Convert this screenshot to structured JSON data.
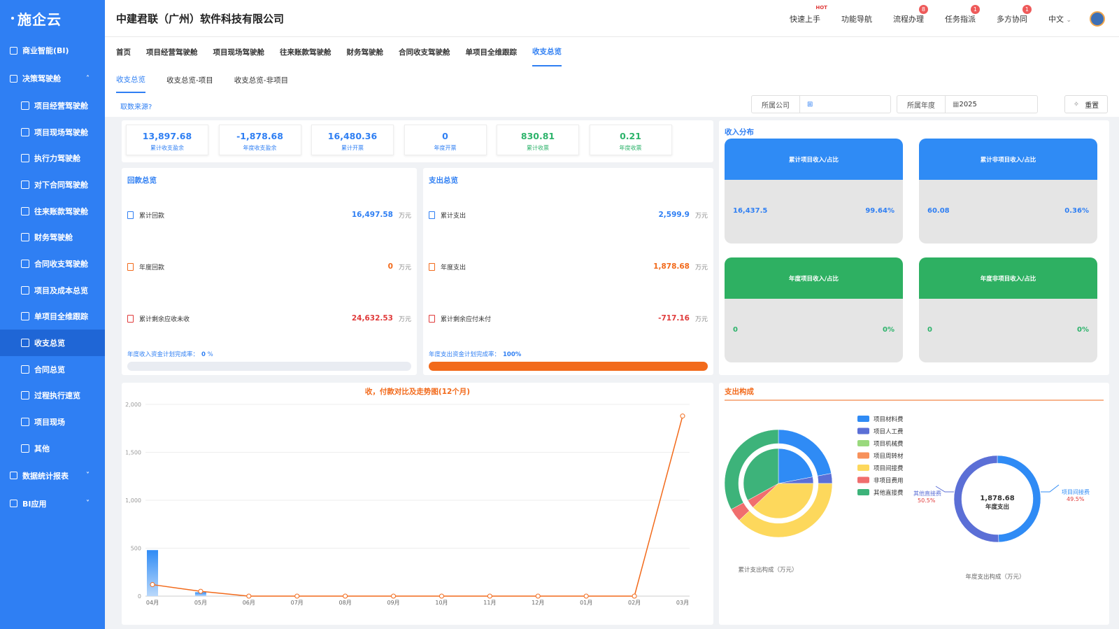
{
  "sidebar": {
    "logo": "施企云",
    "items": [
      {
        "label": "商业智能(BI)",
        "icon": "bi-grid-icon",
        "level": 0
      },
      {
        "label": "决策驾驶舱",
        "icon": "dashboard-icon",
        "level": 0,
        "expanded": true
      },
      {
        "label": "项目经营驾驶舱",
        "icon": "grid-icon",
        "level": 1
      },
      {
        "label": "项目现场驾驶舱",
        "icon": "doc-icon",
        "level": 1
      },
      {
        "label": "执行力驾驶舱",
        "icon": "calendar-check-icon",
        "level": 1
      },
      {
        "label": "对下合同驾驶舱",
        "icon": "contract-icon",
        "level": 1
      },
      {
        "label": "往来账款驾驶舱",
        "icon": "ledger-icon",
        "level": 1
      },
      {
        "label": "财务驾驶舱",
        "icon": "grid-icon",
        "level": 1
      },
      {
        "label": "合同收支驾驶舱",
        "icon": "target-icon",
        "level": 1
      },
      {
        "label": "项目及成本总览",
        "icon": "doc-icon",
        "level": 1
      },
      {
        "label": "单项目全维跟踪",
        "icon": "doc-icon",
        "level": 1
      },
      {
        "label": "收支总览",
        "icon": "money-icon",
        "level": 1,
        "active": true
      },
      {
        "label": "合同总览",
        "icon": "contract-icon",
        "level": 1
      },
      {
        "label": "过程执行速览",
        "icon": "table-icon",
        "level": 1
      },
      {
        "label": "项目现场",
        "icon": "layers-icon",
        "level": 1
      },
      {
        "label": "其他",
        "icon": "cube-icon",
        "level": 1
      },
      {
        "label": "数据统计报表",
        "icon": "report-icon",
        "level": 0,
        "collapsed": true
      },
      {
        "label": "BI应用",
        "icon": "app-icon",
        "level": 0,
        "collapsed": true
      }
    ]
  },
  "header": {
    "company": "中建君联（广州）软件科技有限公司",
    "links": [
      {
        "label": "快速上手",
        "badge": "HOT"
      },
      {
        "label": "功能导航",
        "badge": ""
      },
      {
        "label": "流程办理",
        "badge": "8"
      },
      {
        "label": "任务指派",
        "badge": "1"
      },
      {
        "label": "多方协同",
        "badge": "1"
      }
    ],
    "language": "中文"
  },
  "nav": {
    "tabs": [
      "首页",
      "项目经营驾驶舱",
      "项目现场驾驶舱",
      "往来账款驾驶舱",
      "财务驾驶舱",
      "合同收支驾驶舱",
      "单项目全维跟踪",
      "收支总览"
    ],
    "active": 7
  },
  "subnav": {
    "tabs": [
      "收支总览",
      "收支总览-项目",
      "收支总览-非项目"
    ],
    "active": 0
  },
  "filters": {
    "source_link": "取数来源?",
    "company_label": "所属公司",
    "year_label": "所属年度",
    "year_value": "2025",
    "reset_label": "重置"
  },
  "kpis": [
    {
      "value": "13,897.68",
      "label": "累计收支盈余",
      "color": "#2f7ff3"
    },
    {
      "value": "-1,878.68",
      "label": "年度收支盈余",
      "color": "#2f7ff3"
    },
    {
      "value": "16,480.36",
      "label": "累计开票",
      "color": "#2f7ff3"
    },
    {
      "value": "0",
      "label": "年度开票",
      "color": "#2f7ff3"
    },
    {
      "value": "830.81",
      "label": "累计收票",
      "color": "#2db36b"
    },
    {
      "value": "0.21",
      "label": "年度收票",
      "color": "#2db36b"
    }
  ],
  "receipt": {
    "title": "回款总览",
    "rows": [
      {
        "label": "累计回款",
        "value": "16,497.58",
        "unit": "万元",
        "color": "#2f7ff3"
      },
      {
        "label": "年度回款",
        "value": "0",
        "unit": "万元",
        "color": "#f26a1b"
      },
      {
        "label": "累计剩余应收未收",
        "value": "24,632.53",
        "unit": "万元",
        "color": "#e03b3b"
      }
    ],
    "rate_label": "年度收入资金计划完成率：",
    "rate_value": "0",
    "rate_unit": "%",
    "rate_pct": 0
  },
  "expense": {
    "title": "支出总览",
    "rows": [
      {
        "label": "累计支出",
        "value": "2,599.9",
        "unit": "万元",
        "color": "#2f7ff3"
      },
      {
        "label": "年度支出",
        "value": "1,878.68",
        "unit": "万元",
        "color": "#f26a1b"
      },
      {
        "label": "累计剩余应付未付",
        "value": "-717.16",
        "unit": "万元",
        "color": "#e03b3b"
      }
    ],
    "rate_label": "年度支出资金计划完成率：",
    "rate_value": "100%",
    "rate_pct": 100
  },
  "income_dist": {
    "title": "收入分布",
    "cards": [
      {
        "title": "累计项目收入/占比",
        "value": "16,437.5",
        "pct": "99.64%",
        "color": "#2f8bf5",
        "value_color": "#2f7ff3"
      },
      {
        "title": "累计非项目收入/占比",
        "value": "60.08",
        "pct": "0.36%",
        "color": "#2f8bf5",
        "value_color": "#2f7ff3"
      },
      {
        "title": "年度项目收入/占比",
        "value": "0",
        "pct": "0%",
        "color": "#2eb062",
        "value_color": "#2db36b"
      },
      {
        "title": "年度非项目收入/占比",
        "value": "0",
        "pct": "0%",
        "color": "#2eb062",
        "value_color": "#2db36b"
      }
    ]
  },
  "chart_data": [
    {
      "type": "line",
      "title": "收，付款对比及走势图(12个月)",
      "categories": [
        "04月",
        "05月",
        "06月",
        "07月",
        "08月",
        "09月",
        "10月",
        "11月",
        "12月",
        "01月",
        "02月",
        "03月"
      ],
      "ylim": [
        0,
        2000
      ],
      "yticks": [
        "2,000",
        "1,500",
        "1,000",
        "500",
        "0"
      ],
      "series": [
        {
          "kind": "bar",
          "values": [
            480,
            40,
            0,
            0,
            0,
            0,
            0,
            0,
            0,
            0,
            0,
            0
          ]
        },
        {
          "kind": "line",
          "values": [
            120,
            50,
            0,
            0,
            0,
            0,
            0,
            0,
            0,
            0,
            0,
            1879
          ]
        }
      ],
      "grid": true
    },
    {
      "type": "pie",
      "title": "支出构成",
      "caption_cumulative": "累计支出构成（万元）",
      "caption_annual": "年度支出构成（万元）",
      "legend": [
        "项目材料费",
        "项目人工费",
        "项目机械费",
        "项目周转材",
        "项目间接费",
        "非项目费用",
        "其他直接费"
      ],
      "colors": [
        "#2f8bf5",
        "#5b6fd6",
        "#9ad97d",
        "#f7915a",
        "#fdd85c",
        "#f06e6e",
        "#3db37a"
      ],
      "cumulative_outer": [
        22,
        3,
        0,
        0,
        38,
        4,
        33
      ],
      "cumulative_inner": [
        22,
        3,
        0,
        0,
        38,
        4,
        33
      ],
      "annual_center_value": "1,878.68",
      "annual_center_label": "年度支出",
      "annual_slices": [
        {
          "name": "项目间接费",
          "pct": "49.5%",
          "value": 49.5,
          "color": "#2f8bf5"
        },
        {
          "name": "其他直接费",
          "pct": "50.5%",
          "value": 50.5,
          "color": "#5b6fd6"
        }
      ]
    }
  ]
}
